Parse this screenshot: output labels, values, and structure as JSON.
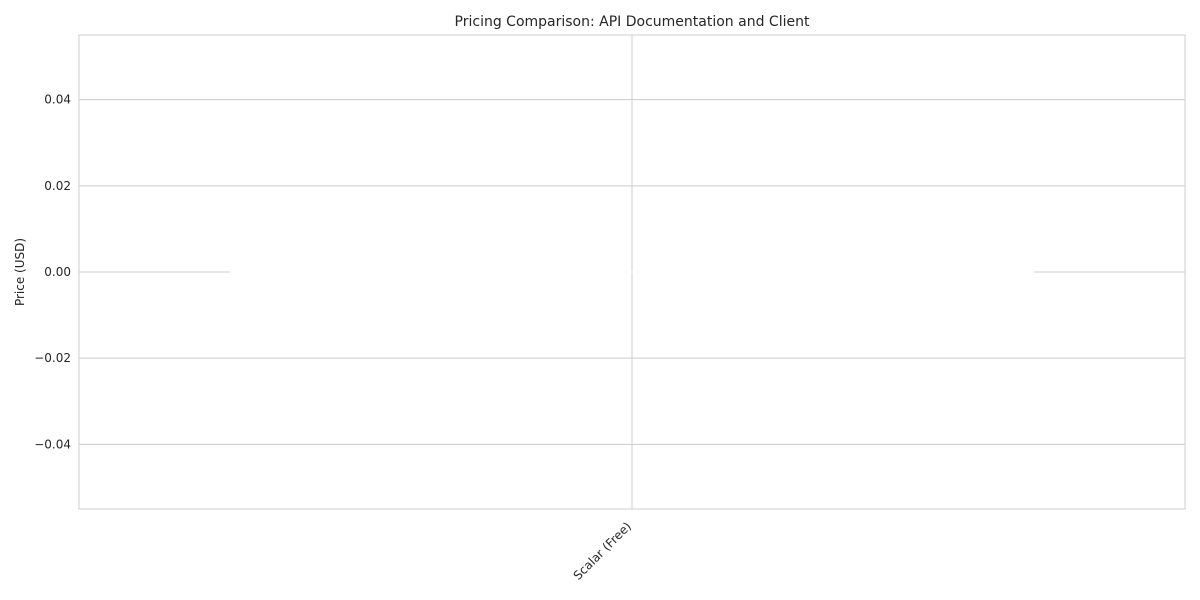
{
  "chart_data": {
    "type": "bar",
    "title": "Pricing Comparison: API Documentation and Client",
    "xlabel": "",
    "ylabel": "Price (USD)",
    "categories": [
      "Scalar (Free)"
    ],
    "values": [
      0
    ],
    "ylim": [
      -0.055,
      0.055
    ],
    "yticks": [
      -0.04,
      -0.02,
      0.0,
      0.02,
      0.04
    ],
    "ytick_labels": [
      "−0.04",
      "−0.02",
      "0.00",
      "0.02",
      "0.04"
    ],
    "grid": true,
    "bar_color": "#fefefe",
    "grid_color": "#cccccc",
    "text_color": "#262626"
  }
}
